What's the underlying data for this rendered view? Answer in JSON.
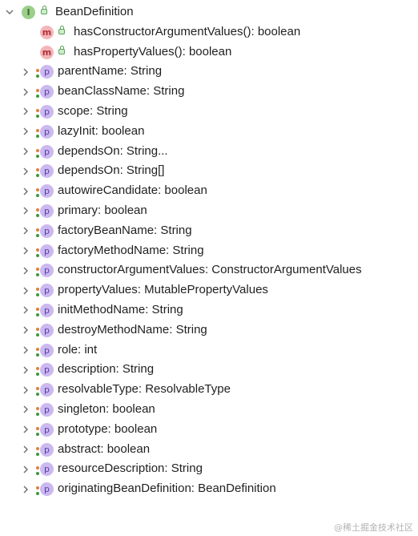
{
  "root": {
    "label": "BeanDefinition",
    "badge": "I"
  },
  "methods": [
    {
      "badge": "m",
      "label": "hasConstructorArgumentValues(): boolean"
    },
    {
      "badge": "m",
      "label": "hasPropertyValues(): boolean"
    }
  ],
  "properties": [
    {
      "badge": "p",
      "label": "parentName: String"
    },
    {
      "badge": "p",
      "label": "beanClassName: String"
    },
    {
      "badge": "p",
      "label": "scope: String"
    },
    {
      "badge": "p",
      "label": "lazyInit: boolean"
    },
    {
      "badge": "p",
      "label": "dependsOn: String..."
    },
    {
      "badge": "p",
      "label": "dependsOn: String[]"
    },
    {
      "badge": "p",
      "label": "autowireCandidate: boolean"
    },
    {
      "badge": "p",
      "label": "primary: boolean"
    },
    {
      "badge": "p",
      "label": "factoryBeanName: String"
    },
    {
      "badge": "p",
      "label": "factoryMethodName: String"
    },
    {
      "badge": "p",
      "label": "constructorArgumentValues: ConstructorArgumentValues"
    },
    {
      "badge": "p",
      "label": "propertyValues: MutablePropertyValues"
    },
    {
      "badge": "p",
      "label": "initMethodName: String"
    },
    {
      "badge": "p",
      "label": "destroyMethodName: String"
    },
    {
      "badge": "p",
      "label": "role: int"
    },
    {
      "badge": "p",
      "label": "description: String"
    },
    {
      "badge": "p",
      "label": "resolvableType: ResolvableType"
    },
    {
      "badge": "p",
      "label": "singleton: boolean"
    },
    {
      "badge": "p",
      "label": "prototype: boolean"
    },
    {
      "badge": "p",
      "label": "abstract: boolean"
    },
    {
      "badge": "p",
      "label": "resourceDescription: String"
    },
    {
      "badge": "p",
      "label": "originatingBeanDefinition: BeanDefinition"
    }
  ],
  "watermark": "@稀土掘金技术社区",
  "colors": {
    "interface_badge": "#9ccf8a",
    "method_badge": "#f3b5b8",
    "property_badge": "#cbb9f0"
  }
}
